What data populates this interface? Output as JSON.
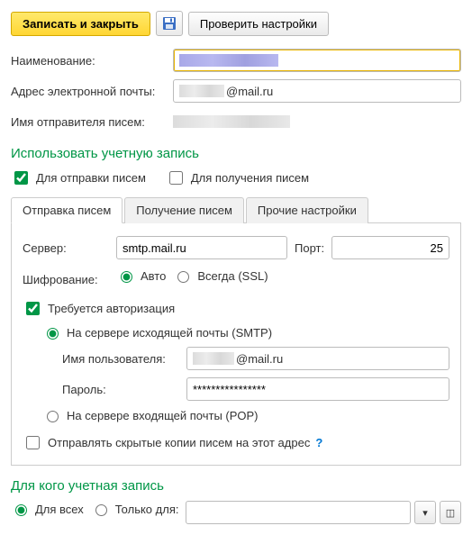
{
  "toolbar": {
    "save_close": "Записать и закрыть",
    "check_settings": "Проверить настройки"
  },
  "fields": {
    "name_label": "Наименование:",
    "email_label": "Адрес электронной почты:",
    "email_value_suffix": "@mail.ru",
    "sender_name_label": "Имя отправителя писем:"
  },
  "use_account": {
    "title": "Использовать учетную запись",
    "for_sending": "Для отправки писем",
    "for_receiving": "Для получения писем"
  },
  "tabs": {
    "sending": "Отправка писем",
    "receiving": "Получение писем",
    "other": "Прочие настройки"
  },
  "smtp": {
    "server_label": "Сервер:",
    "server_value": "smtp.mail.ru",
    "port_label": "Порт:",
    "port_value": "25",
    "encryption_label": "Шифрование:",
    "enc_auto": "Авто",
    "enc_always": "Всегда (SSL)",
    "auth_required": "Требуется авторизация",
    "auth_smtp": "На сервере исходящей почты (SMTP)",
    "auth_pop": "На сервере входящей почты (POP)",
    "username_label": "Имя пользователя:",
    "username_suffix": "@mail.ru",
    "password_label": "Пароль:",
    "password_value": "****************",
    "send_bcc": "Отправлять скрытые копии писем на этот адрес",
    "help": "?"
  },
  "audience": {
    "title": "Для кого учетная запись",
    "for_all": "Для всех",
    "only_for": "Только для:",
    "dropdown_caret": "▾",
    "open_icon": "◫"
  }
}
